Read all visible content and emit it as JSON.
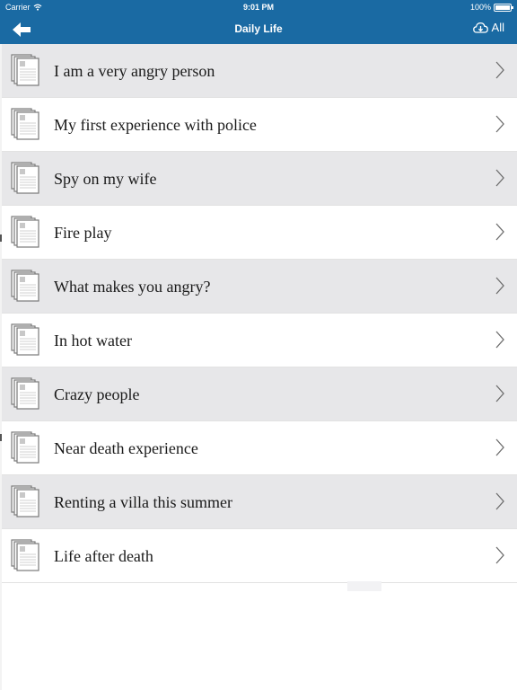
{
  "status_bar": {
    "carrier": "Carrier",
    "time": "9:01 PM",
    "battery": "100%"
  },
  "nav": {
    "title": "Daily Life",
    "download_label": "All"
  },
  "items": [
    {
      "label": "I am a very angry person"
    },
    {
      "label": "My first experience with police"
    },
    {
      "label": "Spy on my wife"
    },
    {
      "label": "Fire play"
    },
    {
      "label": "What makes you angry?"
    },
    {
      "label": "In hot water"
    },
    {
      "label": "Crazy people"
    },
    {
      "label": "Near death experience"
    },
    {
      "label": "Renting a villa this summer"
    },
    {
      "label": "Life after death"
    }
  ],
  "colors": {
    "header": "#1a6aa3",
    "row_shaded": "#e7e7e9",
    "row_plain": "#ffffff"
  },
  "icons": {
    "back": "arrow-left-icon",
    "download": "cloud-download-icon",
    "item": "document-stack-icon",
    "disclosure": "chevron-right-icon"
  }
}
